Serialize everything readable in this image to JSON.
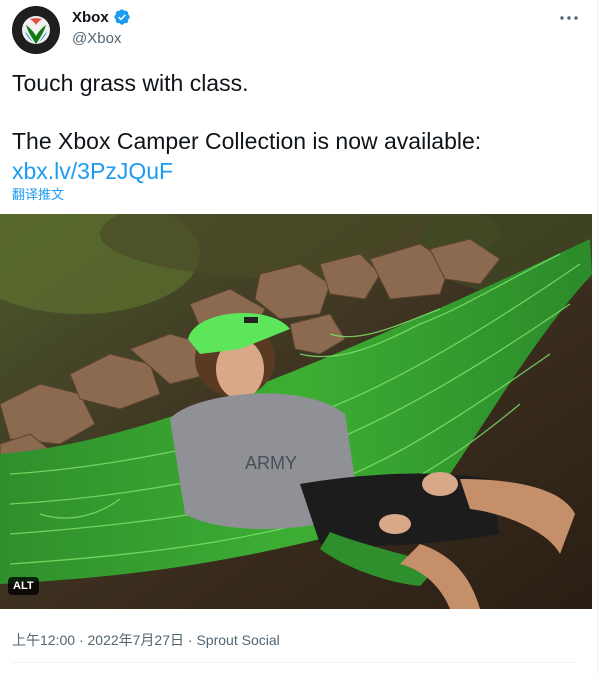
{
  "tweet": {
    "author_name": "Xbox",
    "author_handle": "@Xbox",
    "text_line1": "Touch grass with class.",
    "text_line2": "The Xbox Camper Collection is now available:",
    "link": "xbx.lv/3PzJQuF",
    "translate_label": "翻译推文",
    "media_alt_badge": "ALT",
    "time": "上午12:00",
    "date": "2022年7月27日",
    "source": "Sprout Social",
    "separator": "·"
  },
  "colors": {
    "link": "#1d9bf0",
    "secondary_text": "#536471",
    "verified": "#1d9bf0",
    "xbox_green": "#107c10"
  },
  "icons": {
    "avatar": "xbox-logo-icon",
    "verified": "verified-badge-icon",
    "more": "more-options-icon"
  }
}
